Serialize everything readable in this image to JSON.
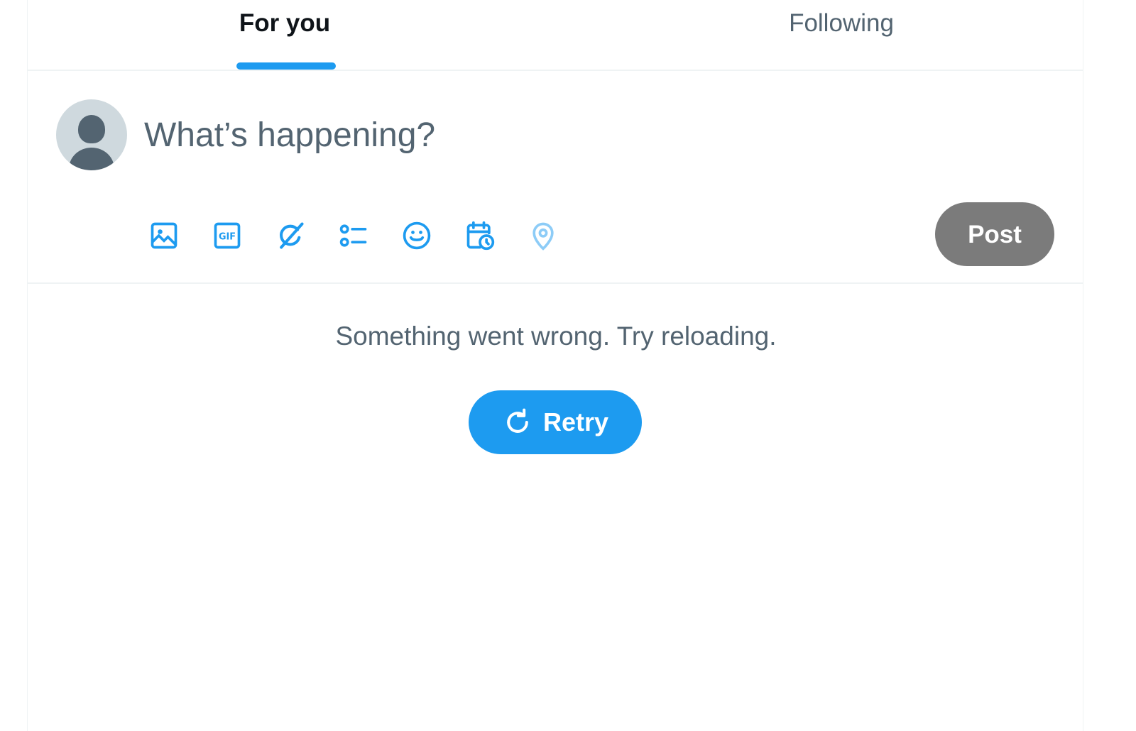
{
  "tabs": {
    "for_you": "For you",
    "following": "Following"
  },
  "composer": {
    "placeholder": "What’s happening?",
    "post_label": "Post",
    "toolbar_icons": [
      "image-icon",
      "gif-icon",
      "grok-icon",
      "poll-icon",
      "emoji-icon",
      "schedule-icon",
      "location-icon"
    ]
  },
  "error": {
    "message": "Something went wrong. Try reloading.",
    "retry_label": "Retry"
  },
  "colors": {
    "accent": "#1d9bf0",
    "post_disabled": "#7b7b7b",
    "secondary_text": "#536471",
    "primary_text": "#0f1419"
  }
}
